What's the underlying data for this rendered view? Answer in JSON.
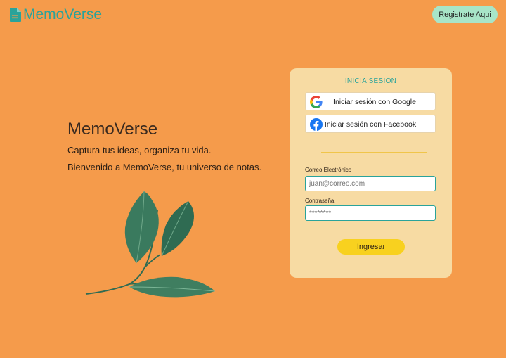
{
  "header": {
    "brand": "MemoVerse",
    "logo_icon": "document-icon",
    "register_label": "Registrate Aqui"
  },
  "hero": {
    "title": "MemoVerse",
    "tagline": "Captura tus ideas, organiza tu vida.",
    "welcome": "Bienvenido a MemoVerse, tu universo de notas."
  },
  "login": {
    "title": "INICIA SESION",
    "google_label": "Iniciar sesión con Google",
    "facebook_label": "Iniciar sesión con Facebook",
    "email_label": "Correo Electrónico",
    "email_placeholder": "juan@correo.com",
    "password_label": "Contraseña",
    "password_placeholder": "********",
    "submit_label": "Ingresar"
  },
  "colors": {
    "background": "#f59b4b",
    "accent": "#2aa39a",
    "card": "#f7dba3",
    "button": "#f8d11f",
    "register_button": "#a8e5c8"
  }
}
